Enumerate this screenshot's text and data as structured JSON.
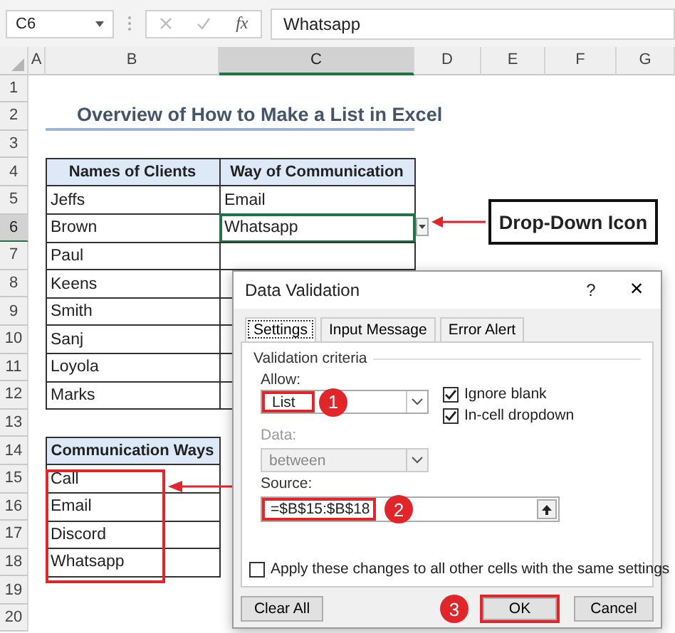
{
  "formula_bar": {
    "name_box": "C6",
    "function_label": "fx",
    "value": "Whatsapp"
  },
  "columns": [
    {
      "label": "A",
      "selected": false
    },
    {
      "label": "B",
      "selected": false
    },
    {
      "label": "C",
      "selected": true
    },
    {
      "label": "D",
      "selected": false
    },
    {
      "label": "E",
      "selected": false
    },
    {
      "label": "F",
      "selected": false
    },
    {
      "label": "G",
      "selected": false
    }
  ],
  "rows": [
    {
      "label": "1",
      "selected": false
    },
    {
      "label": "2",
      "selected": false
    },
    {
      "label": "3",
      "selected": false
    },
    {
      "label": "4",
      "selected": false
    },
    {
      "label": "5",
      "selected": false
    },
    {
      "label": "6",
      "selected": true
    },
    {
      "label": "7",
      "selected": false
    },
    {
      "label": "8",
      "selected": false
    },
    {
      "label": "9",
      "selected": false
    },
    {
      "label": "10",
      "selected": false
    },
    {
      "label": "11",
      "selected": false
    },
    {
      "label": "12",
      "selected": false
    },
    {
      "label": "13",
      "selected": false
    },
    {
      "label": "14",
      "selected": false
    },
    {
      "label": "15",
      "selected": false
    },
    {
      "label": "16",
      "selected": false
    },
    {
      "label": "17",
      "selected": false
    },
    {
      "label": "18",
      "selected": false
    },
    {
      "label": "19",
      "selected": false
    },
    {
      "label": "20",
      "selected": false
    }
  ],
  "title": "Overview of How to Make a List in Excel",
  "clients_table": {
    "columns": [
      "Names of Clients",
      "Way of Communication"
    ],
    "rows": [
      {
        "name": "Jeffs",
        "way": "Email"
      },
      {
        "name": "Brown",
        "way": "Whatsapp"
      },
      {
        "name": "Paul"
      },
      {
        "name": "Keens"
      },
      {
        "name": "Smith"
      },
      {
        "name": "Sanj"
      },
      {
        "name": "Loyola"
      },
      {
        "name": "Marks"
      }
    ]
  },
  "ways_table": {
    "header": "Communication Ways",
    "items": [
      "Call",
      "Email",
      "Discord",
      "Whatsapp"
    ]
  },
  "callout": {
    "label": "Drop-Down Icon"
  },
  "dialog": {
    "title": "Data Validation",
    "help": "?",
    "close": "×",
    "tabs": [
      {
        "label": "Settings",
        "selected": true
      },
      {
        "label": "Input Message",
        "selected": false
      },
      {
        "label": "Error Alert",
        "selected": false
      }
    ],
    "section": "Validation criteria",
    "allow_label": "Allow:",
    "allow_value": "List",
    "checkboxes": [
      {
        "label": "Ignore blank",
        "checked": true
      },
      {
        "label": "In-cell dropdown",
        "checked": true
      }
    ],
    "data_label": "Data:",
    "data_value": "between",
    "source_label": "Source:",
    "source_value": "=$B$15:$B$18",
    "apply": {
      "label": "Apply these changes to all other cells with the same settings",
      "checked": false
    },
    "buttons": [
      "Clear All",
      "OK",
      "Cancel"
    ],
    "steps": [
      "1",
      "2",
      "3"
    ]
  }
}
